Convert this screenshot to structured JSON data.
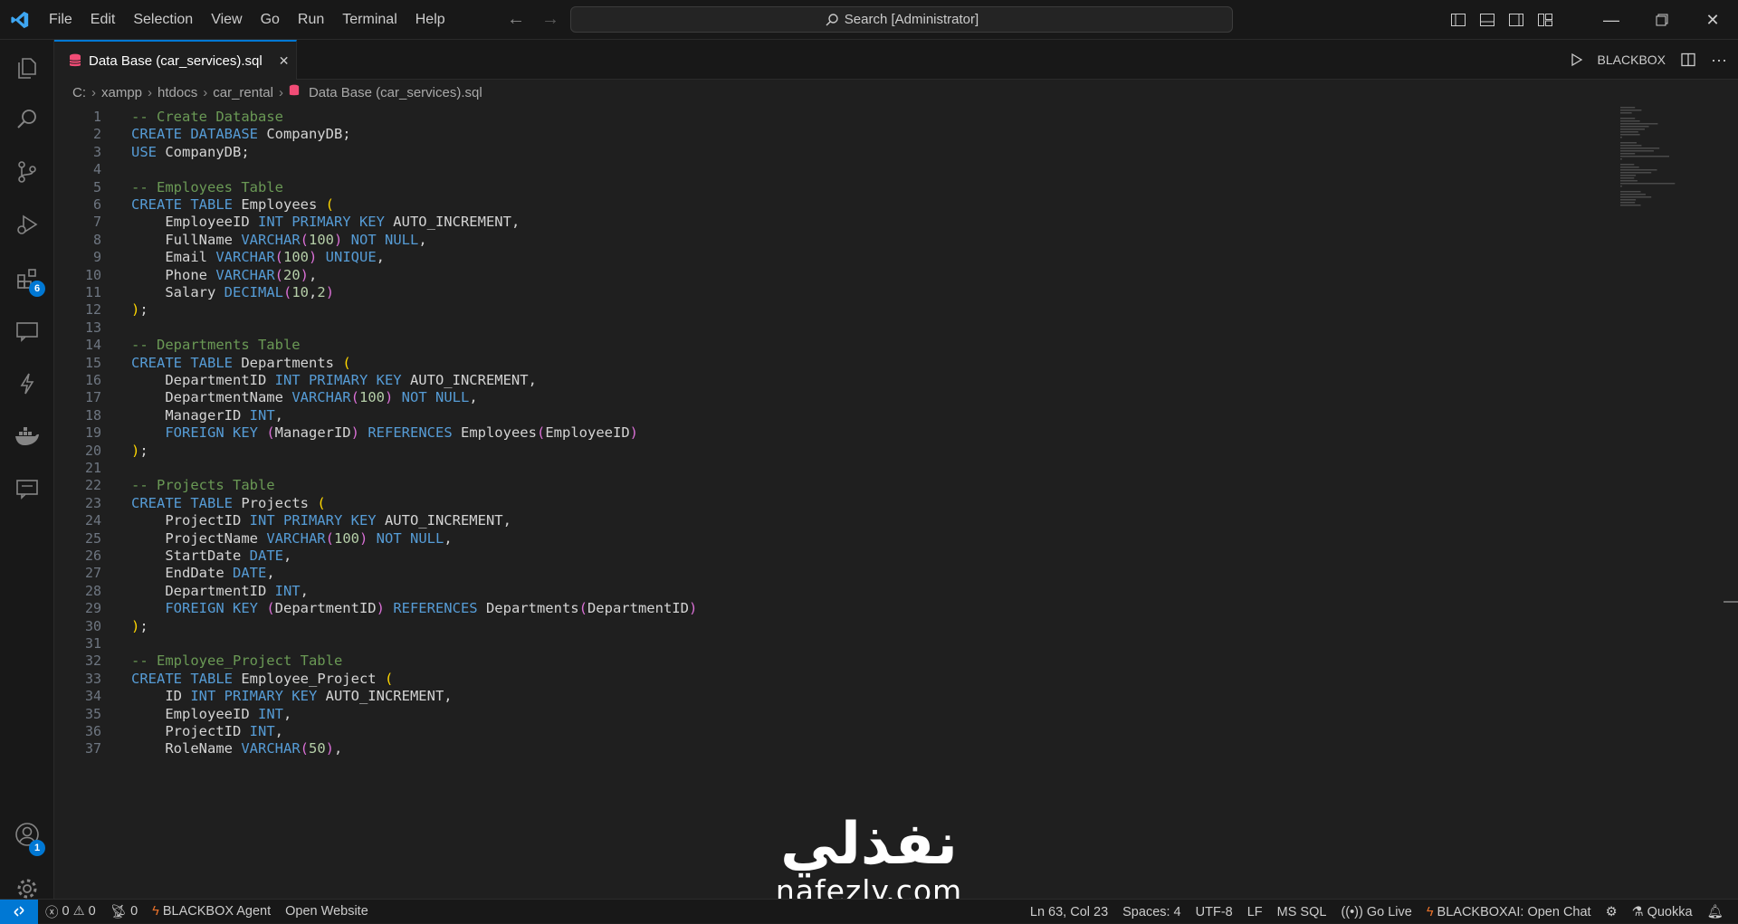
{
  "menu": [
    "File",
    "Edit",
    "Selection",
    "View",
    "Go",
    "Run",
    "Terminal",
    "Help"
  ],
  "search": {
    "label": "Search [Administrator]"
  },
  "activity_badges": {
    "extensions": "6",
    "accounts": "1"
  },
  "tab": {
    "title": "Data Base (car_services).sql",
    "close": "✕"
  },
  "editor_actions": {
    "blackbox": "BLACKBOX"
  },
  "breadcrumb": [
    "C:",
    "xampp",
    "htdocs",
    "car_rental",
    "Data Base (car_services).sql"
  ],
  "code_lines": [
    [
      [
        "c-com",
        "-- Create Database"
      ]
    ],
    [
      [
        "c-kw",
        "CREATE DATABASE "
      ],
      [
        "c-id",
        "CompanyDB;"
      ]
    ],
    [
      [
        "c-kw",
        "USE "
      ],
      [
        "c-id",
        "CompanyDB;"
      ]
    ],
    [],
    [
      [
        "c-com",
        "-- Employees Table"
      ]
    ],
    [
      [
        "c-kw",
        "CREATE TABLE "
      ],
      [
        "c-id",
        "Employees "
      ],
      [
        "c-p1",
        "("
      ]
    ],
    [
      [
        "c-id",
        "    EmployeeID "
      ],
      [
        "c-kw",
        "INT PRIMARY KEY "
      ],
      [
        "c-id",
        "AUTO_INCREMENT,"
      ]
    ],
    [
      [
        "c-id",
        "    FullName "
      ],
      [
        "c-kw",
        "VARCHAR"
      ],
      [
        "c-p2",
        "("
      ],
      [
        "c-num",
        "100"
      ],
      [
        "c-p2",
        ")"
      ],
      [
        "c-kw",
        " NOT NULL"
      ],
      [
        "c-id",
        ","
      ]
    ],
    [
      [
        "c-id",
        "    Email "
      ],
      [
        "c-kw",
        "VARCHAR"
      ],
      [
        "c-p2",
        "("
      ],
      [
        "c-num",
        "100"
      ],
      [
        "c-p2",
        ")"
      ],
      [
        "c-kw",
        " UNIQUE"
      ],
      [
        "c-id",
        ","
      ]
    ],
    [
      [
        "c-id",
        "    Phone "
      ],
      [
        "c-kw",
        "VARCHAR"
      ],
      [
        "c-p2",
        "("
      ],
      [
        "c-num",
        "20"
      ],
      [
        "c-p2",
        ")"
      ],
      [
        "c-id",
        ","
      ]
    ],
    [
      [
        "c-id",
        "    Salary "
      ],
      [
        "c-kw",
        "DECIMAL"
      ],
      [
        "c-p2",
        "("
      ],
      [
        "c-num",
        "10"
      ],
      [
        "c-id",
        ","
      ],
      [
        "c-num",
        "2"
      ],
      [
        "c-p2",
        ")"
      ]
    ],
    [
      [
        "c-p1",
        ")"
      ],
      [
        "c-id",
        ";"
      ]
    ],
    [],
    [
      [
        "c-com",
        "-- Departments Table"
      ]
    ],
    [
      [
        "c-kw",
        "CREATE TABLE "
      ],
      [
        "c-id",
        "Departments "
      ],
      [
        "c-p1",
        "("
      ]
    ],
    [
      [
        "c-id",
        "    DepartmentID "
      ],
      [
        "c-kw",
        "INT PRIMARY KEY "
      ],
      [
        "c-id",
        "AUTO_INCREMENT,"
      ]
    ],
    [
      [
        "c-id",
        "    DepartmentName "
      ],
      [
        "c-kw",
        "VARCHAR"
      ],
      [
        "c-p2",
        "("
      ],
      [
        "c-num",
        "100"
      ],
      [
        "c-p2",
        ")"
      ],
      [
        "c-kw",
        " NOT NULL"
      ],
      [
        "c-id",
        ","
      ]
    ],
    [
      [
        "c-id",
        "    ManagerID "
      ],
      [
        "c-kw",
        "INT"
      ],
      [
        "c-id",
        ","
      ]
    ],
    [
      [
        "c-kw",
        "    FOREIGN KEY "
      ],
      [
        "c-p2",
        "("
      ],
      [
        "c-id",
        "ManagerID"
      ],
      [
        "c-p2",
        ")"
      ],
      [
        "c-kw",
        " REFERENCES "
      ],
      [
        "c-id",
        "Employees"
      ],
      [
        "c-p2",
        "("
      ],
      [
        "c-id",
        "EmployeeID"
      ],
      [
        "c-p2",
        ")"
      ]
    ],
    [
      [
        "c-p1",
        ")"
      ],
      [
        "c-id",
        ";"
      ]
    ],
    [],
    [
      [
        "c-com",
        "-- Projects Table"
      ]
    ],
    [
      [
        "c-kw",
        "CREATE TABLE "
      ],
      [
        "c-id",
        "Projects "
      ],
      [
        "c-p1",
        "("
      ]
    ],
    [
      [
        "c-id",
        "    ProjectID "
      ],
      [
        "c-kw",
        "INT PRIMARY KEY "
      ],
      [
        "c-id",
        "AUTO_INCREMENT,"
      ]
    ],
    [
      [
        "c-id",
        "    ProjectName "
      ],
      [
        "c-kw",
        "VARCHAR"
      ],
      [
        "c-p2",
        "("
      ],
      [
        "c-num",
        "100"
      ],
      [
        "c-p2",
        ")"
      ],
      [
        "c-kw",
        " NOT NULL"
      ],
      [
        "c-id",
        ","
      ]
    ],
    [
      [
        "c-id",
        "    StartDate "
      ],
      [
        "c-kw",
        "DATE"
      ],
      [
        "c-id",
        ","
      ]
    ],
    [
      [
        "c-id",
        "    EndDate "
      ],
      [
        "c-kw",
        "DATE"
      ],
      [
        "c-id",
        ","
      ]
    ],
    [
      [
        "c-id",
        "    DepartmentID "
      ],
      [
        "c-kw",
        "INT"
      ],
      [
        "c-id",
        ","
      ]
    ],
    [
      [
        "c-kw",
        "    FOREIGN KEY "
      ],
      [
        "c-p2",
        "("
      ],
      [
        "c-id",
        "DepartmentID"
      ],
      [
        "c-p2",
        ")"
      ],
      [
        "c-kw",
        " REFERENCES "
      ],
      [
        "c-id",
        "Departments"
      ],
      [
        "c-p2",
        "("
      ],
      [
        "c-id",
        "DepartmentID"
      ],
      [
        "c-p2",
        ")"
      ]
    ],
    [
      [
        "c-p1",
        ")"
      ],
      [
        "c-id",
        ";"
      ]
    ],
    [],
    [
      [
        "c-com",
        "-- Employee_Project Table"
      ]
    ],
    [
      [
        "c-kw",
        "CREATE TABLE "
      ],
      [
        "c-id",
        "Employee_Project "
      ],
      [
        "c-p1",
        "("
      ]
    ],
    [
      [
        "c-id",
        "    ID "
      ],
      [
        "c-kw",
        "INT PRIMARY KEY "
      ],
      [
        "c-id",
        "AUTO_INCREMENT,"
      ]
    ],
    [
      [
        "c-id",
        "    EmployeeID "
      ],
      [
        "c-kw",
        "INT"
      ],
      [
        "c-id",
        ","
      ]
    ],
    [
      [
        "c-id",
        "    ProjectID "
      ],
      [
        "c-kw",
        "INT"
      ],
      [
        "c-id",
        ","
      ]
    ],
    [
      [
        "c-id",
        "    RoleName "
      ],
      [
        "c-kw",
        "VARCHAR"
      ],
      [
        "c-p2",
        "("
      ],
      [
        "c-num",
        "50"
      ],
      [
        "c-p2",
        ")"
      ],
      [
        "c-id",
        ","
      ]
    ]
  ],
  "status": {
    "errors": "0",
    "warnings": "0",
    "ports": "0",
    "blackbox_agent": "BLACKBOX Agent",
    "open_website": "Open Website",
    "position": "Ln 63, Col 23",
    "spaces": "Spaces: 4",
    "encoding": "UTF-8",
    "eol": "LF",
    "language": "MS SQL",
    "golive": "Go Live",
    "blackbox_chat": "BLACKBOXAI: Open Chat",
    "quokka": "Quokka"
  },
  "watermark": {
    "arabic": "نفذلي",
    "latin": "nafezly.com"
  },
  "colors": {
    "accent": "#0078d4",
    "comment": "#6a9955",
    "keyword": "#569cd6",
    "number": "#b5cea8",
    "paren1": "#ffd700",
    "paren2": "#da70d6"
  }
}
